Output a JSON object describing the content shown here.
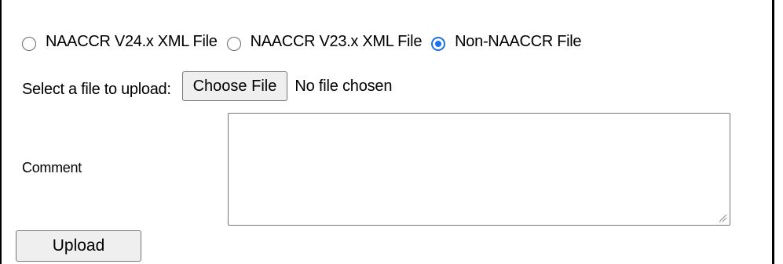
{
  "radio_group": {
    "options": [
      {
        "label": "NAACCR V24.x XML File",
        "checked": false
      },
      {
        "label": "NAACCR V23.x XML File",
        "checked": false
      },
      {
        "label": "Non-NAACCR File",
        "checked": true
      }
    ]
  },
  "file_upload": {
    "label": "Select a file to upload:",
    "button_label": "Choose File",
    "status": "No file chosen"
  },
  "comment": {
    "label": "Comment",
    "value": ""
  },
  "actions": {
    "upload_label": "Upload"
  },
  "colors": {
    "radio_accent": "#1a73e8",
    "button_bg": "#efefef",
    "border": "#767676"
  }
}
